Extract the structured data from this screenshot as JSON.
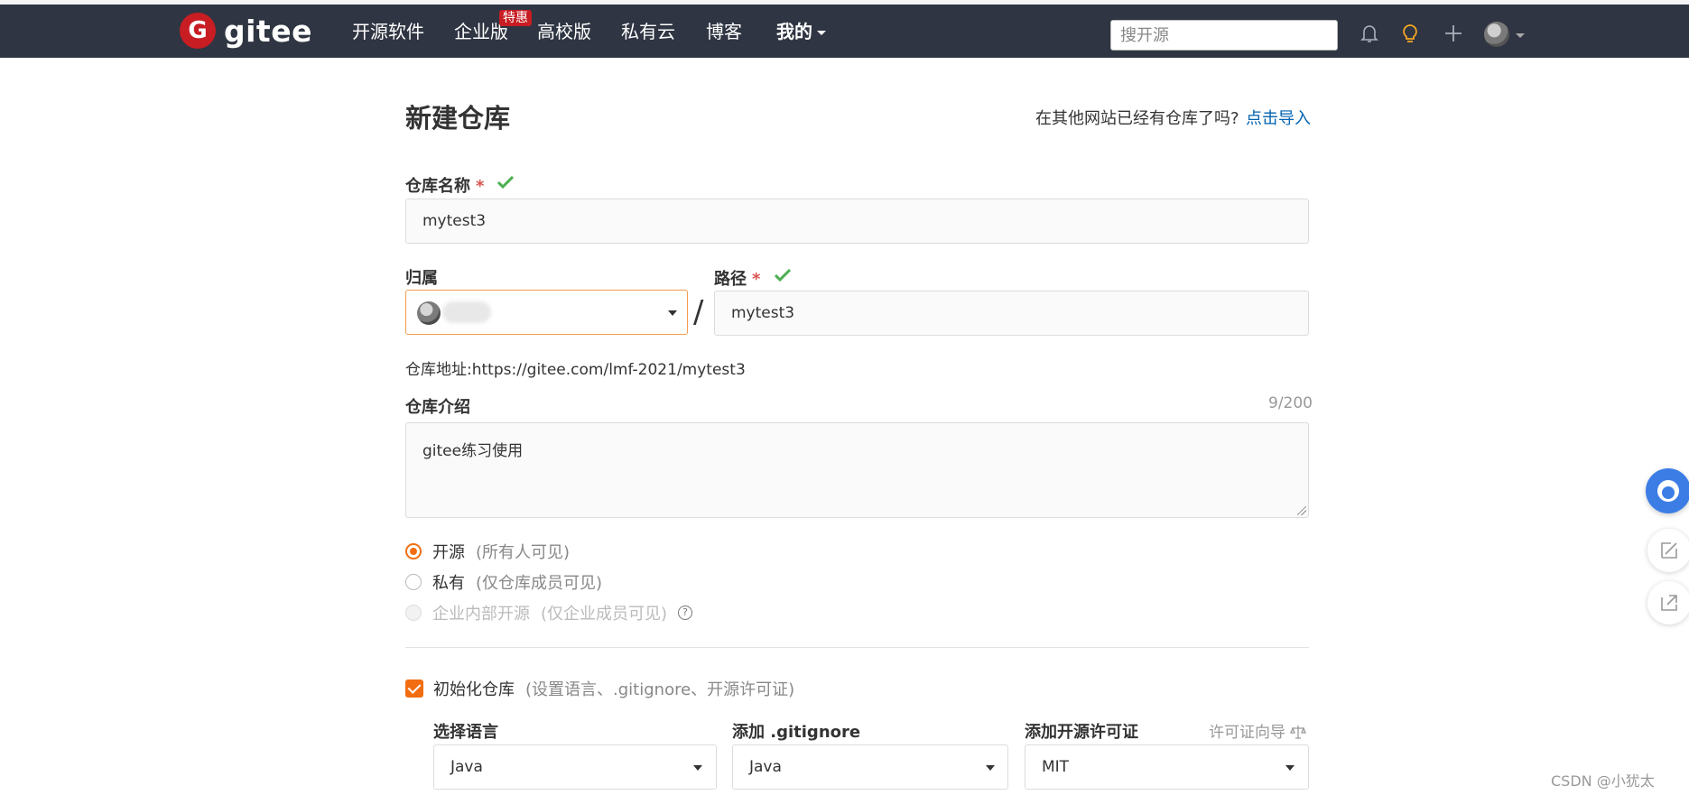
{
  "nav": {
    "logo_text": "gitee",
    "logo_letter": "G",
    "items": [
      "开源软件",
      "企业版",
      "高校版",
      "私有云",
      "博客",
      "我的"
    ],
    "enterprise_badge": "特惠",
    "search_placeholder": "搜开源"
  },
  "page": {
    "title": "新建仓库",
    "import_hint": "在其他网站已经有仓库了吗?",
    "import_link": "点击导入"
  },
  "form": {
    "repo_name_label": "仓库名称",
    "required_mark": "*",
    "repo_name_value": "mytest3",
    "owner_label": "归属",
    "path_label": "路径",
    "path_separator": "/",
    "path_value": "mytest3",
    "repo_url_label": "仓库地址:",
    "repo_url": "https://gitee.com/lmf-2021/mytest3",
    "description_label": "仓库介绍",
    "description_counter": "9/200",
    "description_value": "gitee练习使用",
    "visibility": [
      {
        "label": "开源",
        "hint": "(所有人可见)",
        "selected": true,
        "disabled": false
      },
      {
        "label": "私有",
        "hint": "(仅仓库成员可见)",
        "selected": false,
        "disabled": false
      },
      {
        "label": "企业内部开源",
        "hint": "(仅企业成员可见)",
        "selected": false,
        "disabled": true
      }
    ],
    "help_glyph": "?",
    "init_label": "初始化仓库",
    "init_hint": "(设置语言、.gitignore、开源许可证)",
    "init_checked": true,
    "language_label": "选择语言",
    "language_value": "Java",
    "gitignore_label": "添加 .gitignore",
    "gitignore_value": "Java",
    "license_label": "添加开源许可证",
    "license_guide": "许可证向导",
    "license_value": "MIT"
  },
  "colors": {
    "navbar": "#2f3542",
    "brand_red": "#c71d23",
    "accent_orange": "#f26d11",
    "link_blue": "#0062b0",
    "success_green": "#4caf50"
  },
  "watermark": "CSDN @小犹太"
}
